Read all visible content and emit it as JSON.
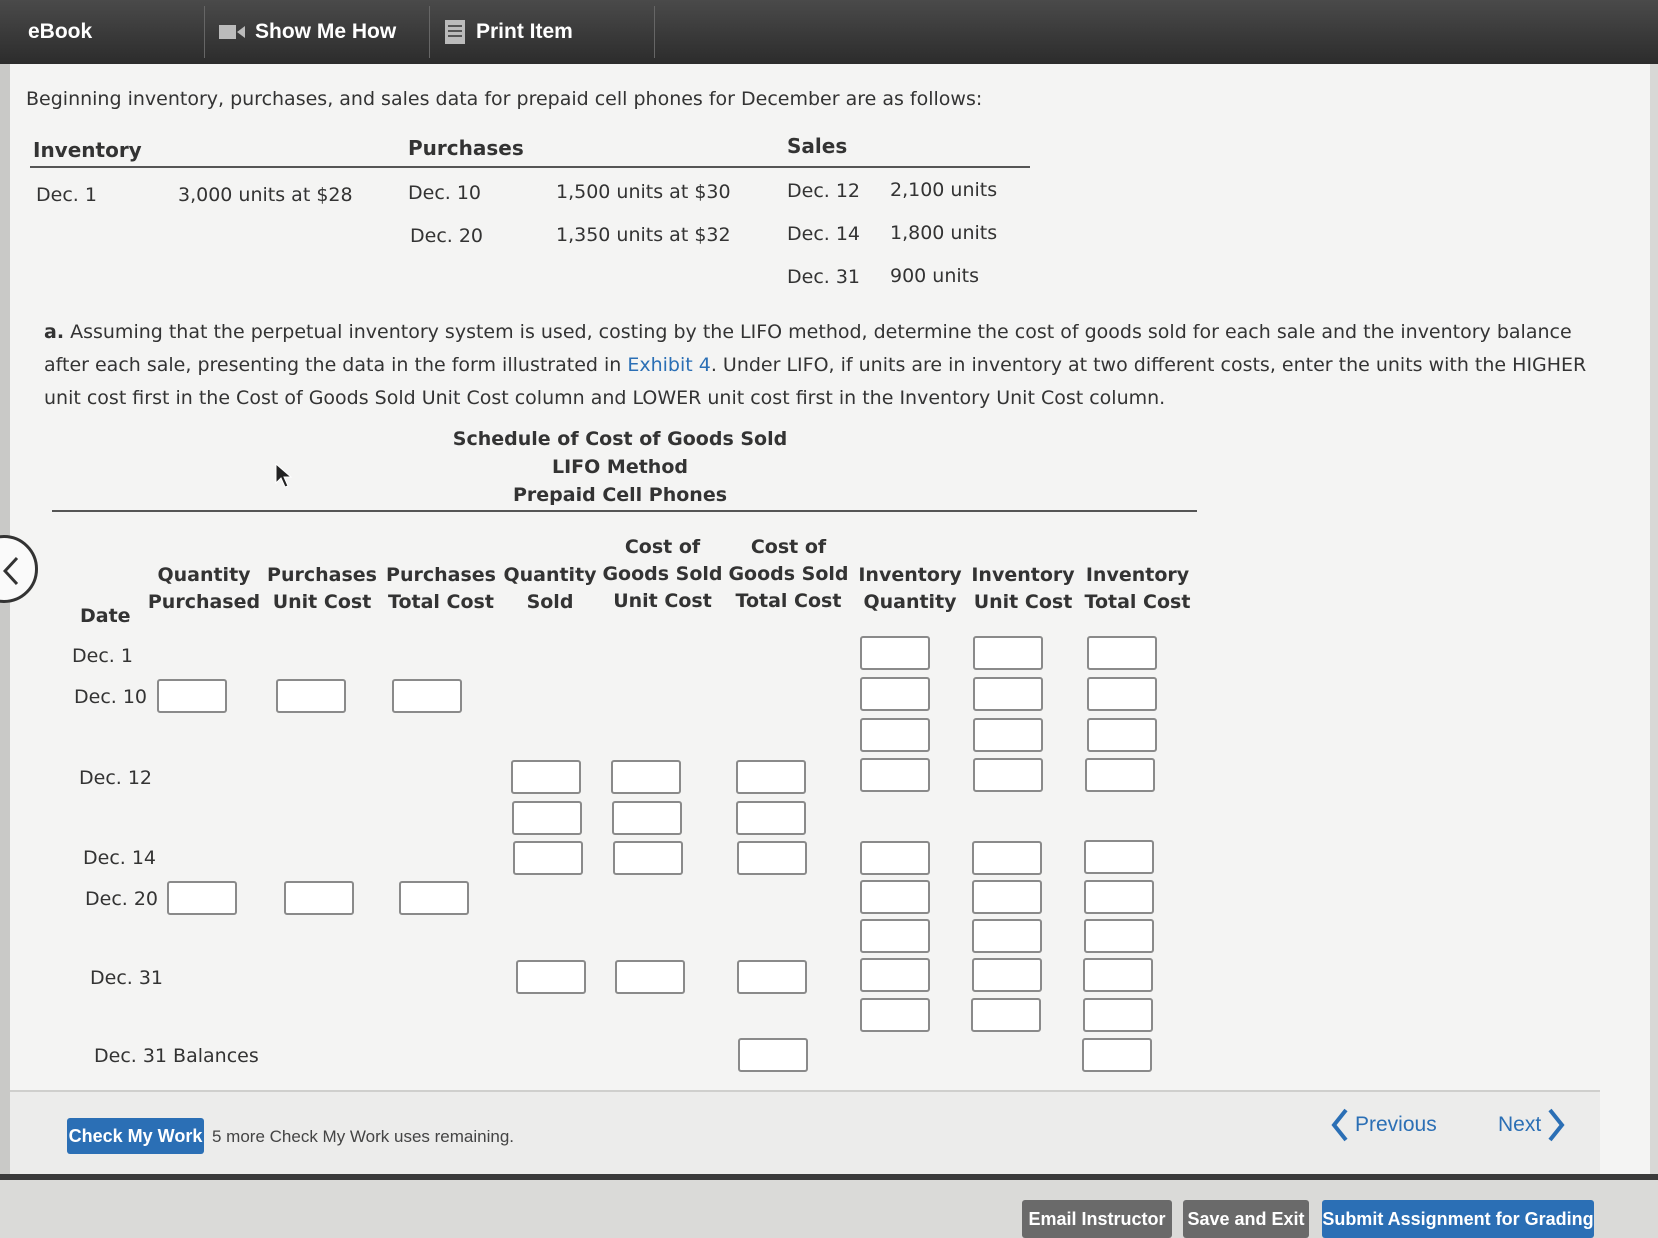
{
  "toolbar": {
    "tabs": [
      {
        "label": "eBook",
        "icon": "book-icon"
      },
      {
        "label": "Show Me How",
        "icon": "video-icon"
      },
      {
        "label": "Print Item",
        "icon": "print-icon"
      }
    ]
  },
  "intro": "Beginning inventory, purchases, and sales data for prepaid cell phones for December are as follows:",
  "data_table": {
    "headers": {
      "inventory": "Inventory",
      "purchases": "Purchases",
      "sales": "Sales"
    },
    "inventory": {
      "date": "Dec. 1",
      "desc": "3,000 units at $28"
    },
    "purchases": [
      {
        "date": "Dec. 10",
        "desc": "1,500 units at $30"
      },
      {
        "date": "Dec. 20",
        "desc": "1,350 units at $32"
      }
    ],
    "sales": [
      {
        "date": "Dec. 12",
        "units": "2,100 units"
      },
      {
        "date": "Dec. 14",
        "units": "1,800 units"
      },
      {
        "date": "Dec. 31",
        "units": "900 units"
      }
    ]
  },
  "question": {
    "label": "a.",
    "text_before": "Assuming that the perpetual inventory system is used, costing by the LIFO method, determine the cost of goods sold for each sale and the inventory balance after each sale, presenting the data in the form illustrated in ",
    "link": "Exhibit 4",
    "text_after": ". Under LIFO, if units are in inventory at two different costs, enter the units with the HIGHER unit cost first in the Cost of Goods Sold Unit Cost column and LOWER unit cost first in the Inventory Unit Cost column."
  },
  "schedule": {
    "title1": "Schedule of Cost of Goods Sold",
    "title2": "LIFO Method",
    "title3": "Prepaid Cell Phones",
    "date_header": "Date",
    "columns": [
      "Quantity\nPurchased",
      "Purchases\nUnit Cost",
      "Purchases\nTotal Cost",
      "Quantity\nSold",
      "Cost of\nGoods Sold\nUnit Cost",
      "Cost of\nGoods Sold\nTotal Cost",
      "Inventory\nQuantity",
      "Inventory\nUnit Cost",
      "Inventory\nTotal Cost"
    ],
    "rows": [
      "Dec. 1",
      "Dec. 10",
      "Dec. 12",
      "Dec. 14",
      "Dec. 20",
      "Dec. 31",
      "Dec. 31  Balances"
    ]
  },
  "bottom": {
    "check_button": "Check My Work",
    "remaining": "5 more Check My Work uses remaining.",
    "previous": "Previous",
    "next": "Next"
  },
  "footer": {
    "email": "Email Instructor",
    "save": "Save and Exit",
    "submit": "Submit Assignment for Grading"
  },
  "colors": {
    "accent": "#2b6fb5",
    "toolbar": "#3a3a3a"
  }
}
